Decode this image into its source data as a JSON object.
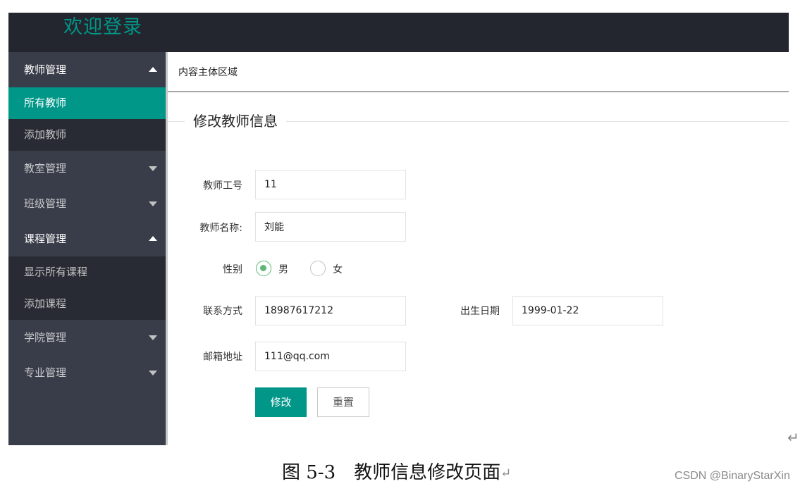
{
  "header": {
    "title": "欢迎登录"
  },
  "sidebar": {
    "groups": [
      {
        "label": "教师管理",
        "expanded": true,
        "children": [
          "所有教师",
          "添加教师"
        ]
      },
      {
        "label": "教室管理",
        "expanded": false
      },
      {
        "label": "班级管理",
        "expanded": false
      },
      {
        "label": "课程管理",
        "expanded": true,
        "children": [
          "显示所有课程",
          "添加课程"
        ]
      },
      {
        "label": "学院管理",
        "expanded": false
      },
      {
        "label": "专业管理",
        "expanded": false
      }
    ],
    "active_item": "所有教师"
  },
  "content": {
    "header": "内容主体区域",
    "legend": "修改教师信息",
    "form": {
      "teacher_id": {
        "label": "教师工号",
        "value": "11"
      },
      "teacher_name": {
        "label": "教师名称:",
        "value": "刘能"
      },
      "gender": {
        "label": "性别",
        "options": [
          "男",
          "女"
        ],
        "selected": "男"
      },
      "phone": {
        "label": "联系方式",
        "value": "18987617212"
      },
      "birth_date": {
        "label": "出生日期",
        "value": "1999-01-22"
      },
      "email": {
        "label": "邮箱地址",
        "value": "111@qq.com"
      },
      "submit_label": "修改",
      "reset_label": "重置"
    }
  },
  "caption": {
    "text": "图 5-3　教师信息修改页面"
  },
  "watermark": {
    "text": "CSDN @BinaryStarXin"
  },
  "colors": {
    "header_bg": "#23262e",
    "sidebar_bg": "#393d49",
    "accent": "#009688",
    "radio_accent": "#5fb878"
  },
  "icons": [
    "caret-up-icon",
    "caret-down-icon",
    "return-arrow-icon"
  ]
}
